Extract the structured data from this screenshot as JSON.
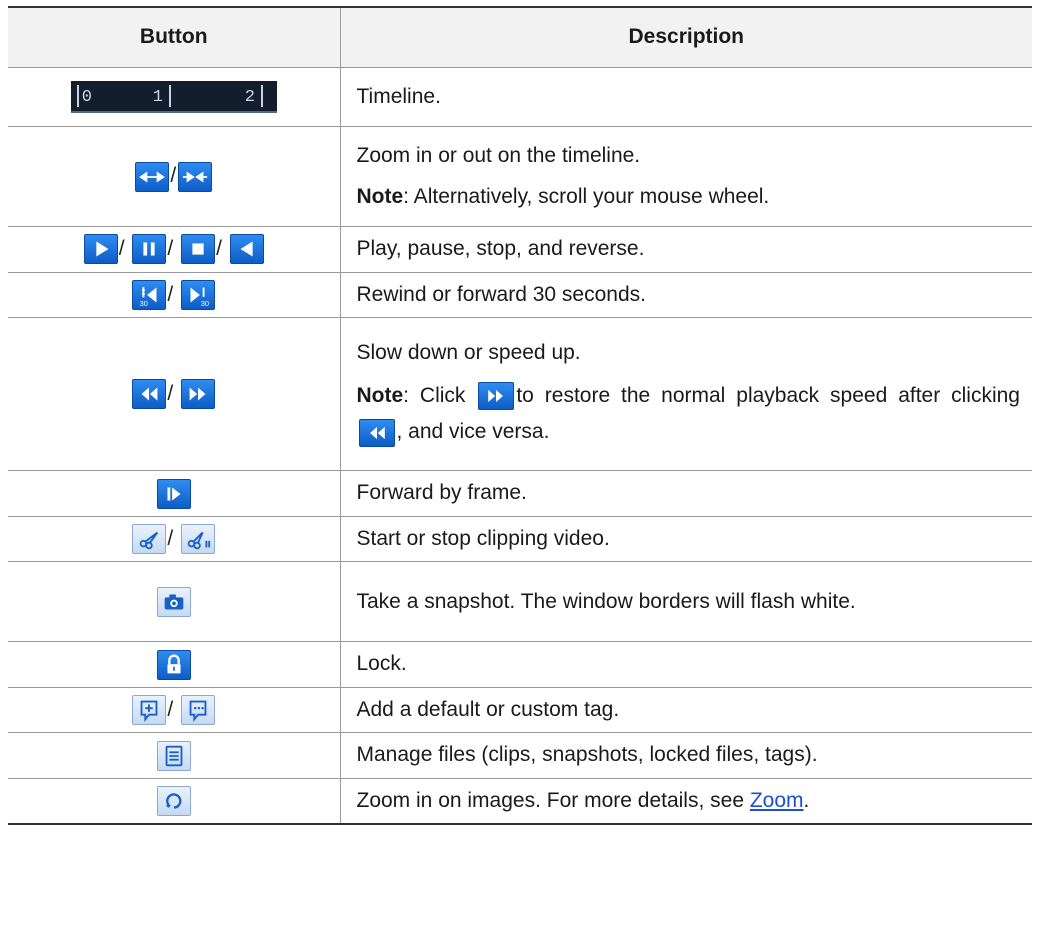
{
  "table": {
    "headers": {
      "button": "Button",
      "description": "Description"
    },
    "timeline": {
      "ticks": [
        "0",
        "1",
        "2"
      ]
    },
    "rows": {
      "timeline": {
        "desc": "Timeline."
      },
      "zoom": {
        "desc": "Zoom in or out on the timeline.",
        "note_label": "Note",
        "note_text": ": Alternatively, scroll your mouse wheel."
      },
      "play": {
        "desc": "Play, pause, stop, and reverse."
      },
      "rewind": {
        "desc": "Rewind or forward 30 seconds.",
        "badge": "30"
      },
      "speed": {
        "desc": "Slow down or speed up.",
        "note_label": "Note",
        "note_pre": ": Click",
        "note_mid": "to restore the normal playback speed after clicking",
        "note_post": ", and vice versa."
      },
      "frame": {
        "desc": "Forward by frame."
      },
      "clip": {
        "desc": "Start or stop clipping video."
      },
      "snapshot": {
        "desc": "Take a snapshot. The window borders will flash white."
      },
      "lock": {
        "desc": "Lock."
      },
      "tag": {
        "desc": "Add a default or custom tag."
      },
      "files": {
        "desc": "Manage files (clips, snapshots, locked files, tags)."
      },
      "zoom_images": {
        "desc": "Zoom in on images. For more details, see ",
        "link": "Zoom",
        "post": "."
      }
    },
    "slash": "/"
  },
  "icons": {
    "accent": "#1a6fe0",
    "names": [
      "timeline-bar",
      "zoom-out-timeline-icon",
      "zoom-in-timeline-icon",
      "play-icon",
      "pause-icon",
      "stop-icon",
      "reverse-icon",
      "rewind-30-icon",
      "forward-30-icon",
      "slow-down-icon",
      "speed-up-icon",
      "frame-forward-icon",
      "clip-start-icon",
      "clip-stop-icon",
      "camera-icon",
      "lock-icon",
      "default-tag-icon",
      "custom-tag-icon",
      "file-manage-icon",
      "zoom-image-icon"
    ]
  }
}
